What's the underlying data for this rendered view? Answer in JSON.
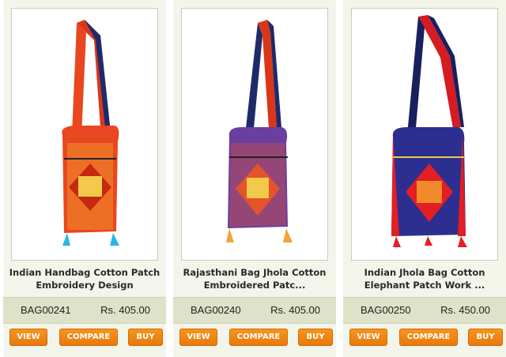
{
  "products": [
    {
      "title_line1": "Indian Handbag Cotton Patch",
      "title_line2": "Embroidery Design",
      "sku": "BAG00241",
      "price": "Rs. 405.00",
      "image_icon": "jhola-bag-orange-icon",
      "colors": {
        "main": "#e8471f",
        "accent": "#f08a2a",
        "strap": "#d9361a",
        "inner": "#1f2a6b",
        "tassel": "#29b6e8"
      }
    },
    {
      "title_line1": "Rajasthani Bag Jhola Cotton",
      "title_line2": "Embroidered Patc...",
      "sku": "BAG00240",
      "price": "Rs. 405.00",
      "image_icon": "jhola-bag-purple-icon",
      "colors": {
        "main": "#6a3fa0",
        "accent": "#e5532a",
        "strap": "#d9361a",
        "inner": "#1f2a6b",
        "tassel": "#f2a43a"
      }
    },
    {
      "title_line1": "Indian Jhola Bag Cotton",
      "title_line2": "Elephant Patch Work ...",
      "sku": "BAG00250",
      "price": "Rs. 450.00",
      "image_icon": "jhola-bag-blue-red-icon",
      "colors": {
        "main": "#2c2f8f",
        "accent": "#e31e24",
        "strap": "#d41c22",
        "inner": "#1a1f5e",
        "tassel": "#e31e24"
      }
    }
  ],
  "buttons": {
    "view": "VIEW",
    "compare": "COMPARE",
    "buy": "BUY"
  }
}
